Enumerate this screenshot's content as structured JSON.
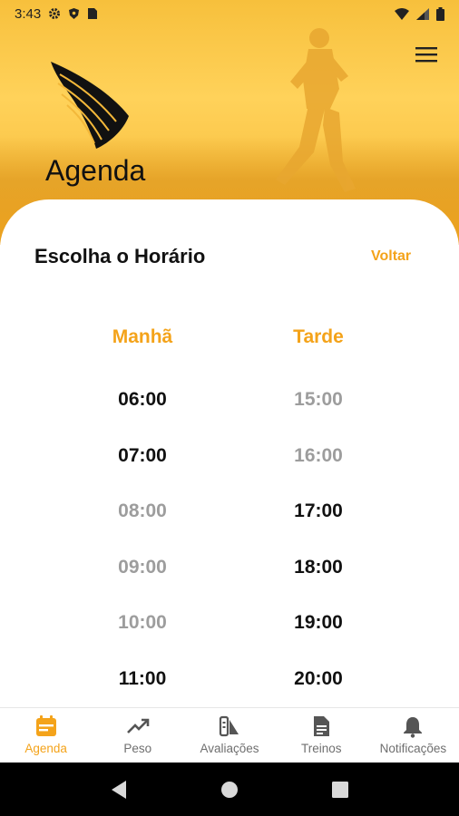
{
  "status_bar": {
    "time": "3:43"
  },
  "header": {
    "title": "Agenda"
  },
  "card": {
    "title": "Escolha o Horário",
    "back_label": "Voltar"
  },
  "schedule": {
    "morning": {
      "label": "Manhã",
      "slots": [
        {
          "time": "06:00",
          "available": true
        },
        {
          "time": "07:00",
          "available": true
        },
        {
          "time": "08:00",
          "available": false
        },
        {
          "time": "09:00",
          "available": false
        },
        {
          "time": "10:00",
          "available": false
        },
        {
          "time": "11:00",
          "available": true
        }
      ]
    },
    "afternoon": {
      "label": "Tarde",
      "slots": [
        {
          "time": "15:00",
          "available": false
        },
        {
          "time": "16:00",
          "available": false
        },
        {
          "time": "17:00",
          "available": true
        },
        {
          "time": "18:00",
          "available": true
        },
        {
          "time": "19:00",
          "available": true
        },
        {
          "time": "20:00",
          "available": true
        }
      ]
    }
  },
  "bottom_nav": {
    "items": [
      {
        "label": "Agenda",
        "icon": "calendar-icon",
        "active": true
      },
      {
        "label": "Peso",
        "icon": "trending-up-icon",
        "active": false
      },
      {
        "label": "Avaliações",
        "icon": "assessment-icon",
        "active": false
      },
      {
        "label": "Treinos",
        "icon": "document-icon",
        "active": false
      },
      {
        "label": "Notificações",
        "icon": "bell-icon",
        "active": false
      }
    ]
  },
  "colors": {
    "accent": "#f4a31a",
    "available": "#111111",
    "unavailable": "#9d9d9d",
    "hero": "#f7c03c"
  }
}
